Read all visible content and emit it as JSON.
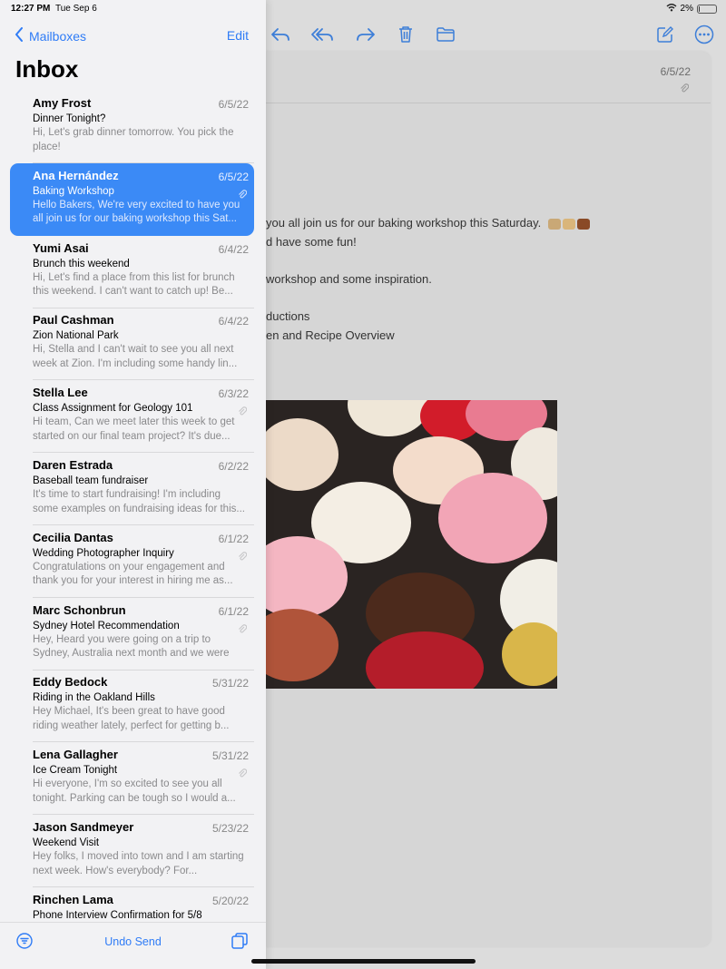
{
  "status": {
    "time": "12:27 PM",
    "date": "Tue Sep 6",
    "battery": "2%",
    "battery_level": 0.02
  },
  "sidebar": {
    "back_label": "Mailboxes",
    "edit_label": "Edit",
    "title": "Inbox",
    "mails": [
      {
        "sender": "Amy Frost",
        "date": "6/5/22",
        "subject": "Dinner Tonight?",
        "preview": "Hi, Let's grab dinner tomorrow. You pick the place!",
        "attachment": false
      },
      {
        "sender": "Ana Hernández",
        "date": "6/5/22",
        "subject": "Baking Workshop",
        "preview": "Hello Bakers, We're very excited to have you all join us for our baking workshop this Sat...",
        "attachment": true
      },
      {
        "sender": "Yumi Asai",
        "date": "6/4/22",
        "subject": "Brunch this weekend",
        "preview": "Hi, Let's find a place from this list for brunch this weekend. I can't want to catch up! Be...",
        "attachment": false
      },
      {
        "sender": "Paul Cashman",
        "date": "6/4/22",
        "subject": "Zion National Park",
        "preview": "Hi, Stella and I can't wait to see you all next week at Zion. I'm including some handy lin...",
        "attachment": false
      },
      {
        "sender": "Stella Lee",
        "date": "6/3/22",
        "subject": "Class Assignment for Geology 101",
        "preview": "Hi team, Can we meet later this week to get started on our final team project? It's due...",
        "attachment": true
      },
      {
        "sender": "Daren Estrada",
        "date": "6/2/22",
        "subject": "Baseball team fundraiser",
        "preview": "It's time to start fundraising! I'm including some examples on fundraising ideas for this...",
        "attachment": false
      },
      {
        "sender": "Cecilia Dantas",
        "date": "6/1/22",
        "subject": "Wedding Photographer Inquiry",
        "preview": "Congratulations on your engagement and thank you for your interest in hiring me as...",
        "attachment": true
      },
      {
        "sender": "Marc Schonbrun",
        "date": "6/1/22",
        "subject": "Sydney Hotel Recommendation",
        "preview": "Hey, Heard you were going on a trip to Sydney, Australia next month and we were loo...",
        "attachment": true
      },
      {
        "sender": "Eddy Bedock",
        "date": "5/31/22",
        "subject": "Riding in the Oakland Hills",
        "preview": "Hey Michael, It's been great to have good riding weather lately, perfect for getting b...",
        "attachment": false
      },
      {
        "sender": "Lena Gallagher",
        "date": "5/31/22",
        "subject": "Ice Cream Tonight",
        "preview": "Hi everyone, I'm so excited to see you all tonight. Parking can be tough so I would a...",
        "attachment": true
      },
      {
        "sender": "Jason Sandmeyer",
        "date": "5/23/22",
        "subject": "Weekend Visit",
        "preview": "Hey folks, I moved into town and I am starting next week. How's everybody? For...",
        "attachment": false
      },
      {
        "sender": "Rinchen Lama",
        "date": "5/20/22",
        "subject": "Phone Interview Confirmation for 5/8",
        "preview": "",
        "attachment": false
      }
    ],
    "undo_send_label": "Undo Send"
  },
  "message": {
    "date": "6/5/22",
    "lines": [
      "you all join us for our baking workshop this Saturday.",
      "d have some fun!",
      "workshop and some inspiration.",
      "ductions",
      "en and Recipe Overview"
    ]
  },
  "colors": {
    "accent": "#2f7cf6",
    "selected": "#3b8af6"
  },
  "icons": [
    "reply-icon",
    "reply-all-icon",
    "forward-icon",
    "trash-icon",
    "folder-icon",
    "compose-icon",
    "more-icon",
    "paperclip-icon",
    "filter-icon",
    "multitask-icon",
    "wifi-icon",
    "chevron-left-icon"
  ]
}
